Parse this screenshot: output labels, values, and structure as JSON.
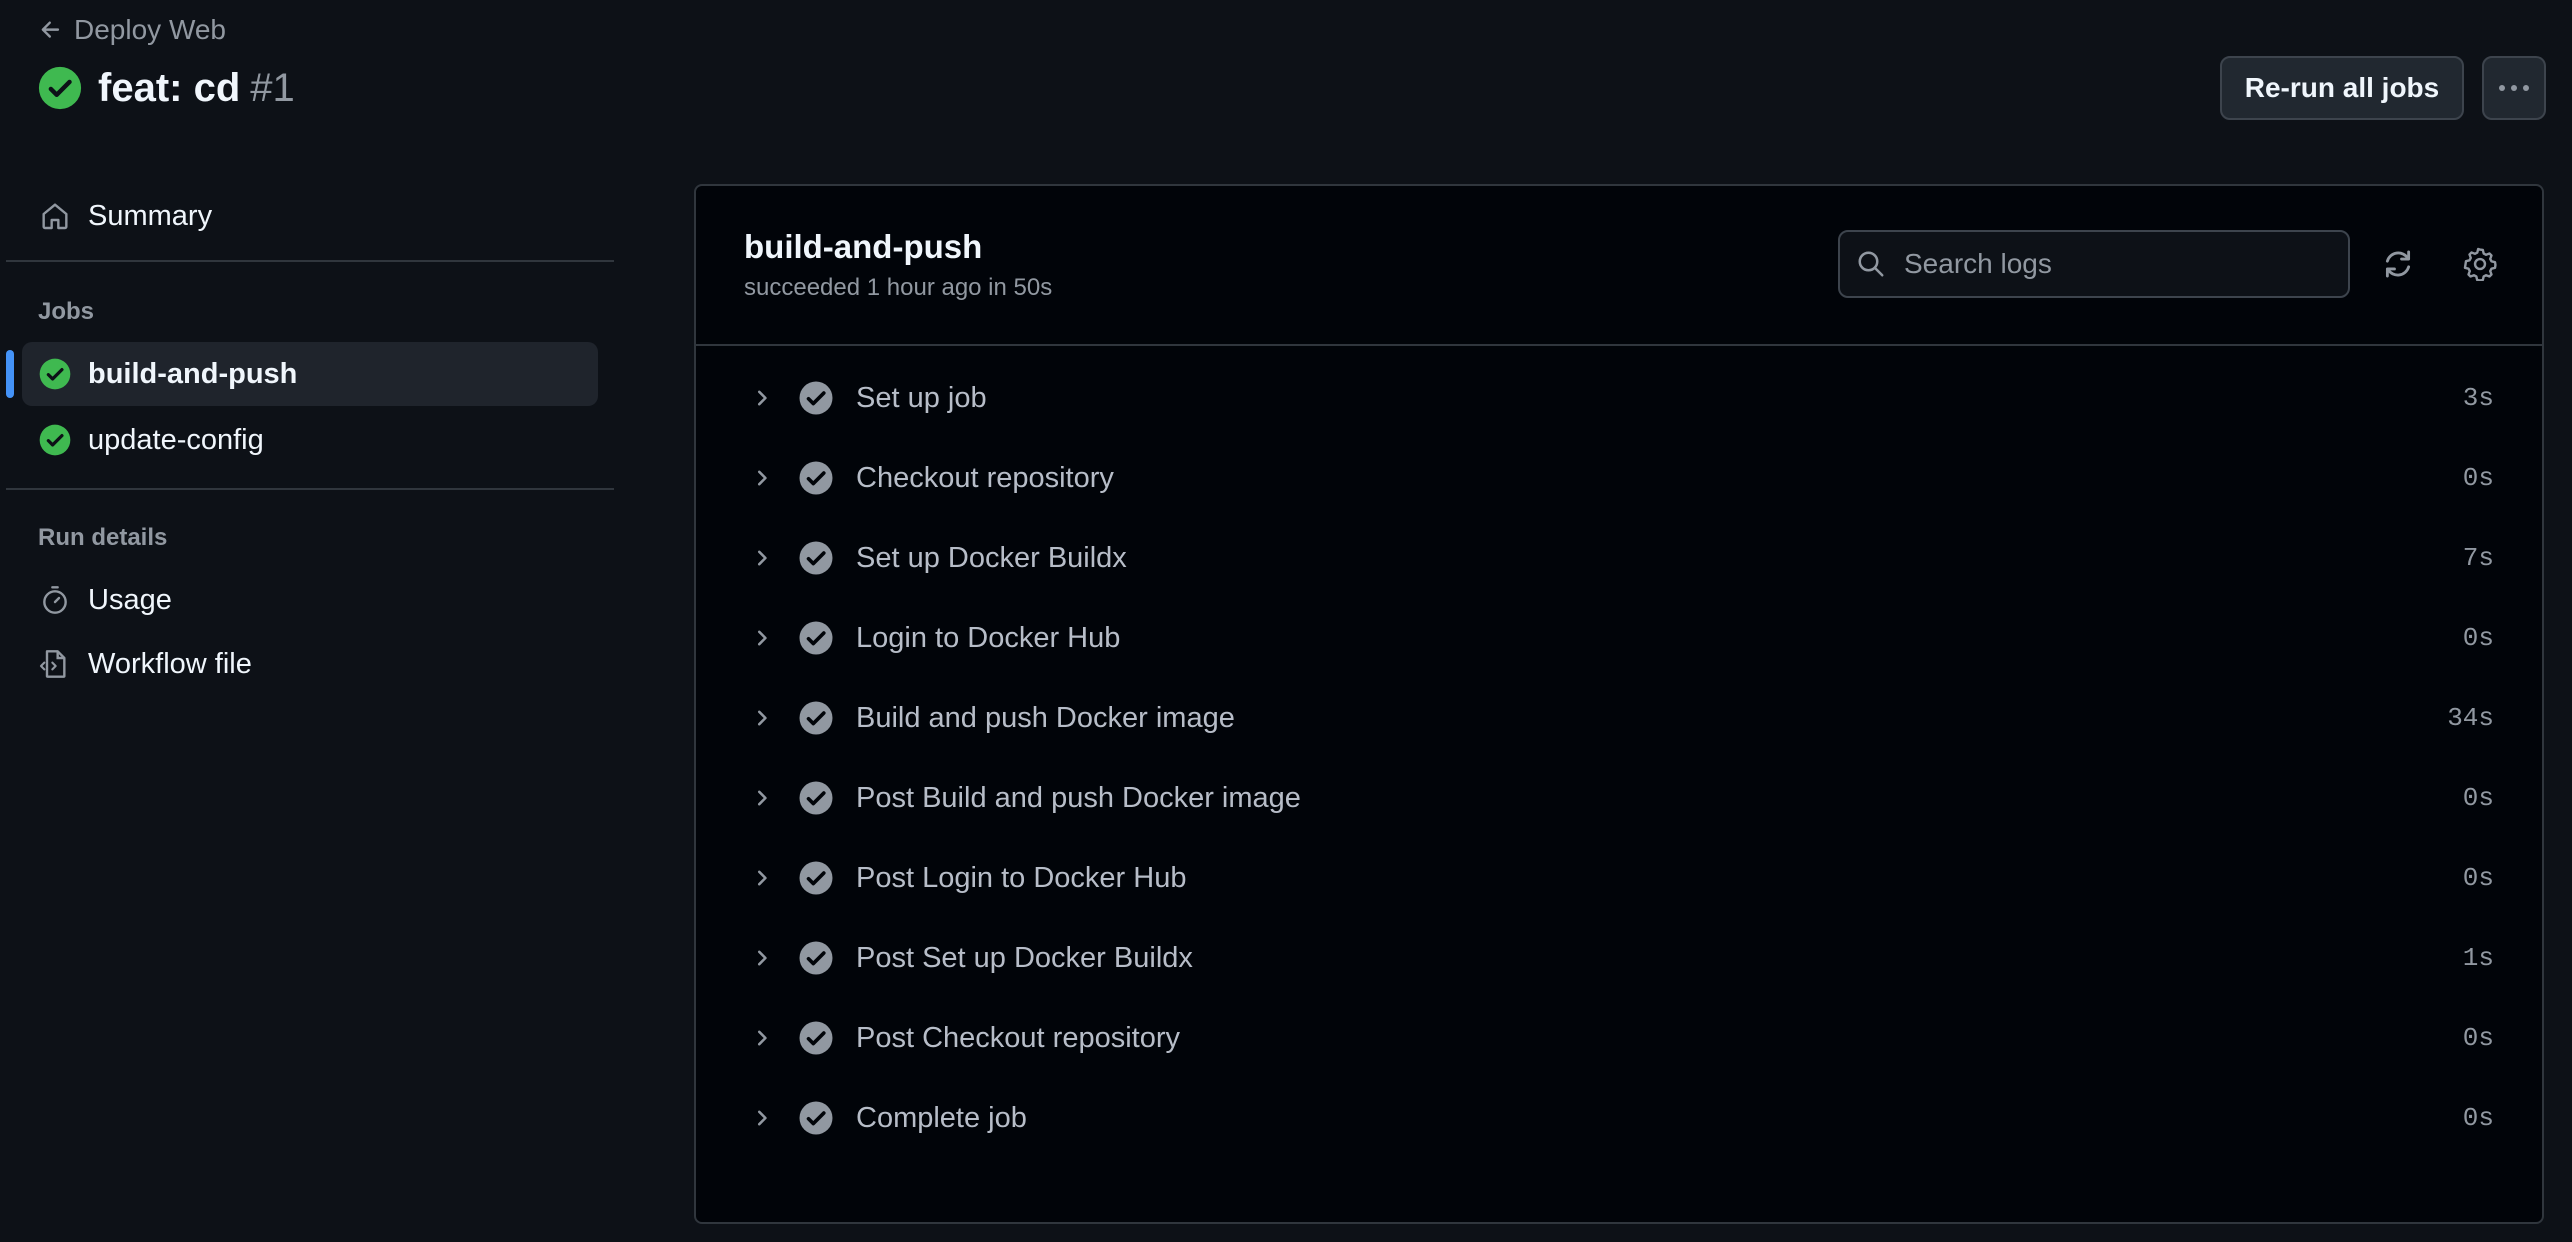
{
  "header": {
    "back_label": "Deploy Web",
    "title": "feat: cd",
    "run_number": "#1",
    "rerun_label": "Re-run all jobs",
    "more_label": "···"
  },
  "sidebar": {
    "summary_label": "Summary",
    "jobs_heading": "Jobs",
    "jobs": [
      {
        "label": "build-and-push",
        "status": "success",
        "active": true
      },
      {
        "label": "update-config",
        "status": "success",
        "active": false
      }
    ],
    "run_details_heading": "Run details",
    "usage_label": "Usage",
    "workflow_file_label": "Workflow file"
  },
  "job": {
    "title": "build-and-push",
    "subtitle": "succeeded 1 hour ago in 50s",
    "search_placeholder": "Search logs",
    "steps": [
      {
        "name": "Set up job",
        "duration": "3s"
      },
      {
        "name": "Checkout repository",
        "duration": "0s"
      },
      {
        "name": "Set up Docker Buildx",
        "duration": "7s"
      },
      {
        "name": "Login to Docker Hub",
        "duration": "0s"
      },
      {
        "name": "Build and push Docker image",
        "duration": "34s"
      },
      {
        "name": "Post Build and push Docker image",
        "duration": "0s"
      },
      {
        "name": "Post Login to Docker Hub",
        "duration": "0s"
      },
      {
        "name": "Post Set up Docker Buildx",
        "duration": "1s"
      },
      {
        "name": "Post Checkout repository",
        "duration": "0s"
      },
      {
        "name": "Complete job",
        "duration": "0s"
      }
    ]
  },
  "colors": {
    "background": "#0d1117",
    "panel": "#010409",
    "success": "#3fb950",
    "step_check": "#9198a1",
    "accent": "#4493f8"
  },
  "icons": [
    "arrow-left-icon",
    "check-circle-icon",
    "home-icon",
    "stopwatch-icon",
    "file-code-icon",
    "search-icon",
    "sync-icon",
    "gear-icon",
    "chevron-right-icon",
    "kebab-horizontal-icon"
  ]
}
